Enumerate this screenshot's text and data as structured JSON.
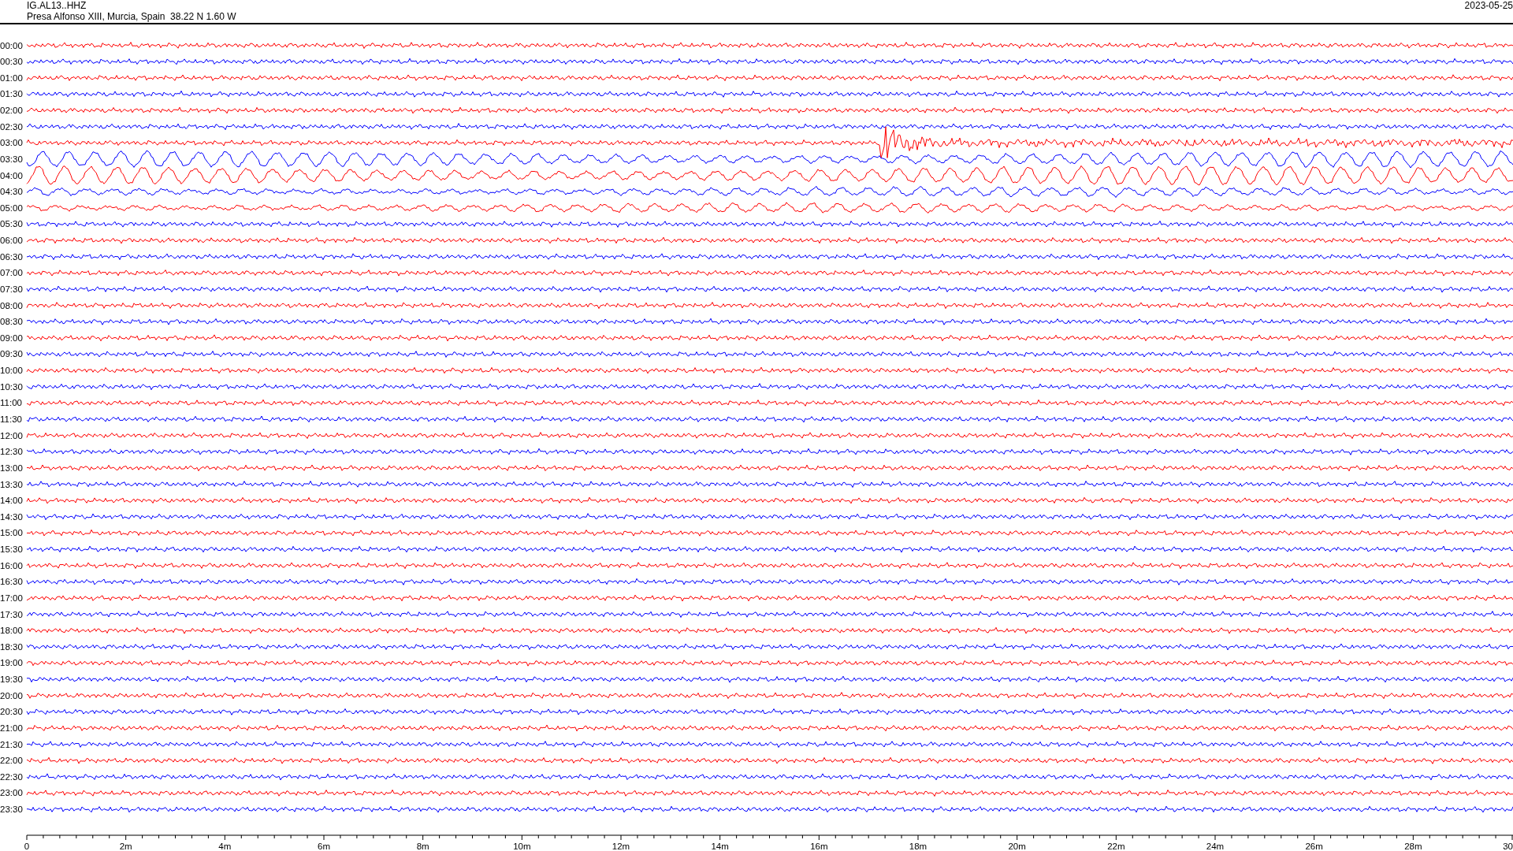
{
  "header": {
    "station": "IG.AL13..HHZ",
    "location": "Presa Alfonso XIII, Murcia, Spain  38.22 N 1.60 W",
    "date": "2023-05-25"
  },
  "traces": [
    {
      "label": "00:00",
      "color": "#ff0000",
      "kind": "quiet"
    },
    {
      "label": "00:30",
      "color": "#0000ff",
      "kind": "quiet"
    },
    {
      "label": "01:00",
      "color": "#ff0000",
      "kind": "quiet"
    },
    {
      "label": "01:30",
      "color": "#0000ff",
      "kind": "quiet"
    },
    {
      "label": "02:00",
      "color": "#ff0000",
      "kind": "quiet"
    },
    {
      "label": "02:30",
      "color": "#0000ff",
      "kind": "quiet"
    },
    {
      "label": "03:00",
      "color": "#ff0000",
      "kind": "event"
    },
    {
      "label": "03:30",
      "color": "#0000ff",
      "kind": "swell"
    },
    {
      "label": "04:00",
      "color": "#ff0000",
      "kind": "swell"
    },
    {
      "label": "04:30",
      "color": "#0000ff",
      "kind": "swell"
    },
    {
      "label": "05:00",
      "color": "#ff0000",
      "kind": "swell"
    },
    {
      "label": "05:30",
      "color": "#0000ff",
      "kind": "quiet"
    },
    {
      "label": "06:00",
      "color": "#ff0000",
      "kind": "quiet"
    },
    {
      "label": "06:30",
      "color": "#0000ff",
      "kind": "quiet"
    },
    {
      "label": "07:00",
      "color": "#ff0000",
      "kind": "quiet"
    },
    {
      "label": "07:30",
      "color": "#0000ff",
      "kind": "quiet"
    },
    {
      "label": "08:00",
      "color": "#ff0000",
      "kind": "quiet"
    },
    {
      "label": "08:30",
      "color": "#0000ff",
      "kind": "quiet"
    },
    {
      "label": "09:00",
      "color": "#ff0000",
      "kind": "quiet"
    },
    {
      "label": "09:30",
      "color": "#0000ff",
      "kind": "quiet"
    },
    {
      "label": "10:00",
      "color": "#ff0000",
      "kind": "quiet"
    },
    {
      "label": "10:30",
      "color": "#0000ff",
      "kind": "quiet"
    },
    {
      "label": "11:00",
      "color": "#ff0000",
      "kind": "quiet"
    },
    {
      "label": "11:30",
      "color": "#0000ff",
      "kind": "quiet"
    },
    {
      "label": "12:00",
      "color": "#ff0000",
      "kind": "quiet"
    },
    {
      "label": "12:30",
      "color": "#0000ff",
      "kind": "quiet"
    },
    {
      "label": "13:00",
      "color": "#ff0000",
      "kind": "quiet"
    },
    {
      "label": "13:30",
      "color": "#0000ff",
      "kind": "quiet"
    },
    {
      "label": "14:00",
      "color": "#ff0000",
      "kind": "quiet"
    },
    {
      "label": "14:30",
      "color": "#0000ff",
      "kind": "quiet"
    },
    {
      "label": "15:00",
      "color": "#ff0000",
      "kind": "quiet"
    },
    {
      "label": "15:30",
      "color": "#0000ff",
      "kind": "quiet"
    },
    {
      "label": "16:00",
      "color": "#ff0000",
      "kind": "quiet"
    },
    {
      "label": "16:30",
      "color": "#0000ff",
      "kind": "quiet"
    },
    {
      "label": "17:00",
      "color": "#ff0000",
      "kind": "quiet"
    },
    {
      "label": "17:30",
      "color": "#0000ff",
      "kind": "quiet"
    },
    {
      "label": "18:00",
      "color": "#ff0000",
      "kind": "quiet"
    },
    {
      "label": "18:30",
      "color": "#0000ff",
      "kind": "quiet"
    },
    {
      "label": "19:00",
      "color": "#ff0000",
      "kind": "quiet"
    },
    {
      "label": "19:30",
      "color": "#0000ff",
      "kind": "quiet"
    },
    {
      "label": "20:00",
      "color": "#ff0000",
      "kind": "quiet"
    },
    {
      "label": "20:30",
      "color": "#0000ff",
      "kind": "quiet"
    },
    {
      "label": "21:00",
      "color": "#ff0000",
      "kind": "quiet"
    },
    {
      "label": "21:30",
      "color": "#0000ff",
      "kind": "quiet"
    },
    {
      "label": "22:00",
      "color": "#ff0000",
      "kind": "quiet"
    },
    {
      "label": "22:30",
      "color": "#0000ff",
      "kind": "quiet"
    },
    {
      "label": "23:00",
      "color": "#ff0000",
      "kind": "quiet"
    },
    {
      "label": "23:30",
      "color": "#0000ff",
      "kind": "quiet"
    }
  ],
  "time_axis": {
    "labels": [
      "0",
      "2m",
      "4m",
      "6m",
      "8m",
      "10m",
      "12m",
      "14m",
      "16m",
      "18m",
      "20m",
      "22m",
      "24m",
      "26m",
      "28m",
      "30"
    ]
  }
}
